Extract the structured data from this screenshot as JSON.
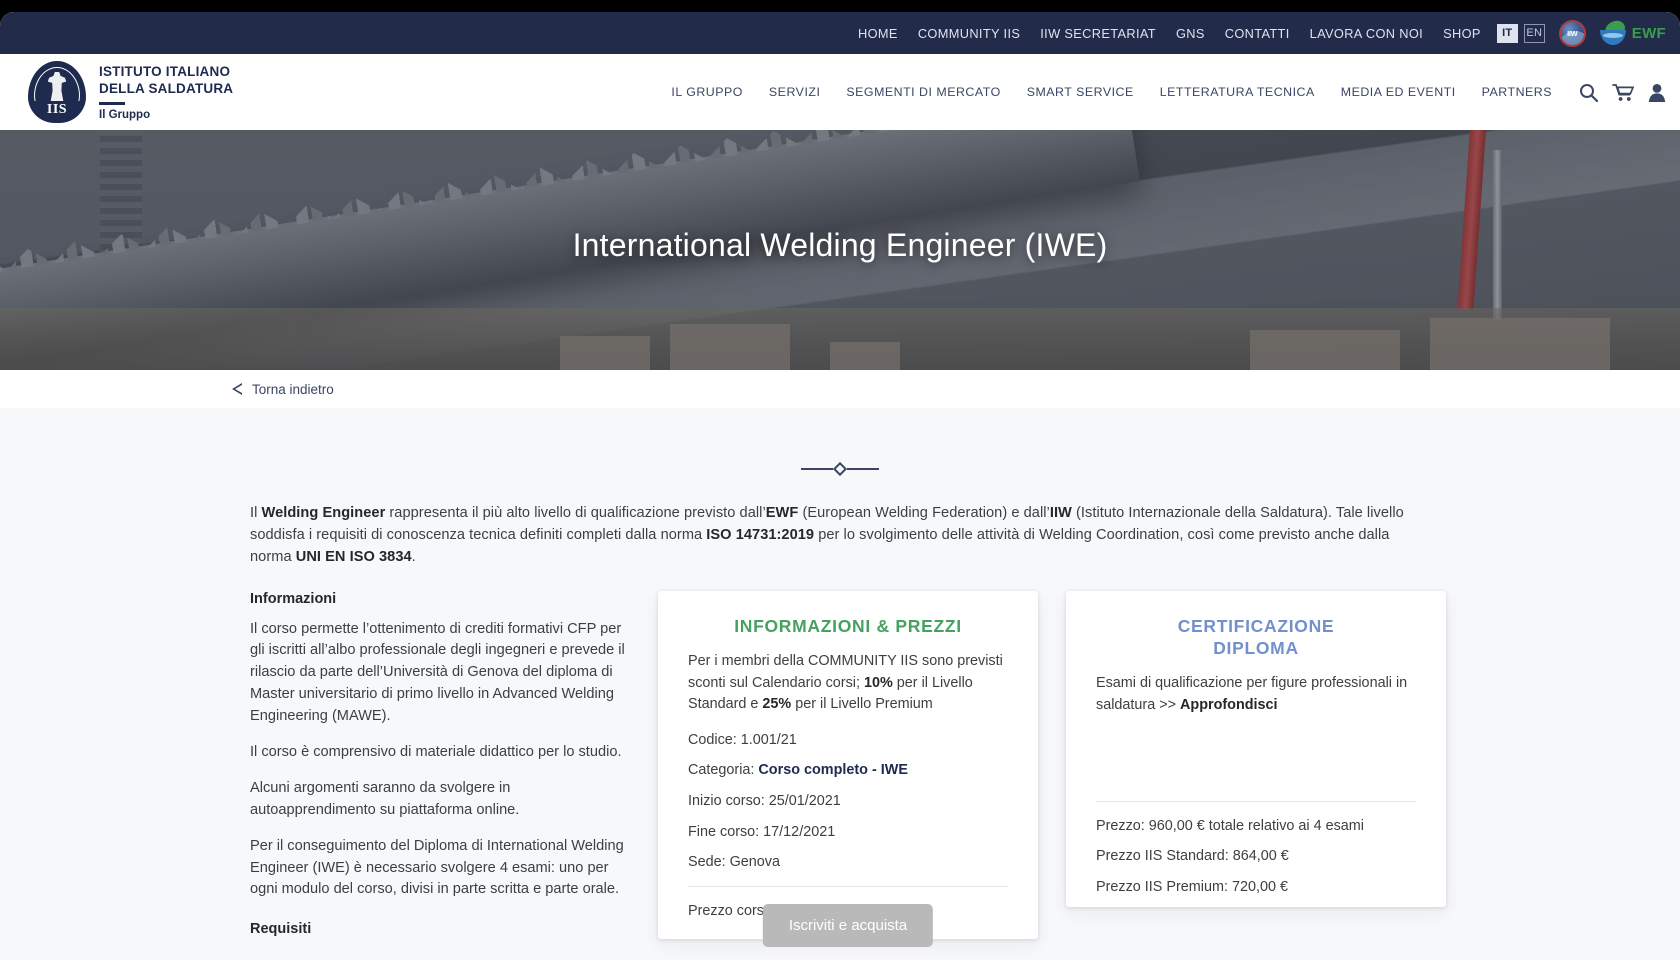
{
  "topbar": {
    "links": [
      {
        "label": "HOME"
      },
      {
        "label": "COMMUNITY IIS"
      },
      {
        "label": "IIW SECRETARIAT"
      },
      {
        "label": "GNS"
      },
      {
        "label": "CONTATTI"
      },
      {
        "label": "LAVORA CON NOI"
      },
      {
        "label": "SHOP"
      }
    ],
    "lang_active": "IT",
    "lang_inactive": "EN",
    "logo_iiw": "iiw-logo",
    "logo_ewf": "ewf-logo",
    "logo_ewf_text": "EWF",
    "bg_color": "#222b49"
  },
  "brand": {
    "line1": "ISTITUTO ITALIANO",
    "line2": "DELLA SALDATURA",
    "line3": "Il Gruppo",
    "crest_text": "IIS",
    "color": "#1e2a4e"
  },
  "mainnav": {
    "items": [
      {
        "label": "IL GRUPPO"
      },
      {
        "label": "SERVIZI"
      },
      {
        "label": "SEGMENTI DI MERCATO"
      },
      {
        "label": "SMART SERVICE"
      },
      {
        "label": "LETTERATURA TECNICA"
      },
      {
        "label": "MEDIA ED EVENTI"
      },
      {
        "label": "PARTNERS"
      }
    ],
    "icons": [
      "search-icon",
      "cart-icon",
      "user-icon"
    ]
  },
  "hero": {
    "title": "International Welding Engineer (IWE)"
  },
  "back_link": {
    "label": "Torna indietro"
  },
  "intro": {
    "html": "Il <b>Welding Engineer</b> rappresenta il più alto livello di qualificazione previsto dall’<b>EWF</b> (European Welding Federation) e dall’<b>IIW</b> (Istituto Internazionale della Saldatura). Tale livello soddisfa i requisiti di conoscenza tecnica definiti completi dalla norma <b>ISO 14731:2019</b> per lo svolgimento delle attività di Welding Coordination, così come previsto anche dalla norma <b>UNI EN ISO 3834</b>."
  },
  "left_column": {
    "heading": "Informazioni",
    "paragraphs": [
      "Il corso permette l’ottenimento di crediti formativi CFP per gli iscritti all’albo professionale degli ingegneri e prevede il rilascio da parte dell’Università di Genova del diploma di Master universitario di primo livello in Advanced Welding Engineering (MAWE).",
      "Il corso è comprensivo di materiale didattico per lo studio.",
      "Alcuni argomenti saranno da svolgere in autoapprendimento su piattaforma online.",
      "Per il conseguimento del Diploma di International Welding Engineer (IWE) è necessario svolgere 4 esami: uno per ogni modulo del corso, divisi in parte scritta e parte orale."
    ],
    "heading2": "Requisiti"
  },
  "card_prezzi": {
    "title": "INFORMAZIONI & PREZZI",
    "title_color": "#46a060",
    "lead_html": "Per i membri della COMMUNITY IIS sono previsti sconti sul Calendario corsi; <b>10%</b> per il Livello Standard e <b>25%</b> per il Livello Premium",
    "rows": [
      {
        "html": "Codice: 1.001/21"
      },
      {
        "html": "Categoria: <b>Corso completo - IWE</b>"
      },
      {
        "html": "Inizio corso: 25/01/2021"
      },
      {
        "html": "Fine corso: 17/12/2021"
      },
      {
        "html": "Sede: Genova"
      }
    ],
    "price_row": "Prezzo corso:  9.400,00 €",
    "button_label": "Iscriviti e acquista",
    "button_color": "#b9b9b9"
  },
  "card_cert": {
    "title_line1": "CERTIFICAZIONE",
    "title_line2": "DIPLOMA",
    "title_color": "#7390cd",
    "lead_html": "Esami di qualificazione per figure professionali in saldatura >> <b>Approfondisci</b>",
    "rows": [
      {
        "html": "Prezzo:  960,00 € totale relativo ai 4 esami"
      },
      {
        "html": "Prezzo IIS Standard:  864,00 €"
      },
      {
        "html": "Prezzo IIS Premium:  720,00 €"
      }
    ]
  }
}
